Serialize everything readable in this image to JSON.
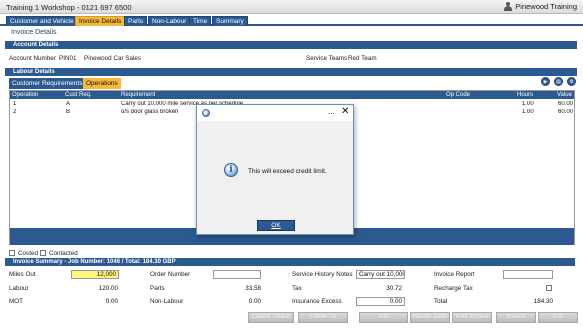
{
  "app": {
    "title": "Training 1 Workshop - 0121 697 6500",
    "user": "Pinewood Training"
  },
  "tabs": [
    {
      "label": "Customer and Vehicle"
    },
    {
      "label": "Invoice Details"
    },
    {
      "label": "Parts"
    },
    {
      "label": "Non-Labour"
    },
    {
      "label": "Time"
    },
    {
      "label": "Summary"
    }
  ],
  "breadcrumb": "Invoice Details",
  "account": {
    "header": "Account Details",
    "number_label": "Account Number",
    "number": "PIN01",
    "name": "Pinewood Car Sales",
    "service_teams_label": "Service Teams",
    "service_team": "Red Team"
  },
  "labour": {
    "header": "Labour Details",
    "inner_tabs": [
      "Customer Requirements",
      "Operations"
    ],
    "columns": [
      "Operation",
      "Cust Req.",
      "Requirement",
      "Op Code",
      "Hours",
      "Value"
    ],
    "rows": [
      {
        "operation": "1",
        "cust_req": "A",
        "requirement": "Carry out 10,000 mile service as per schedule",
        "op_code": "",
        "hours": "1.00",
        "value": "60.00"
      },
      {
        "operation": "2",
        "cust_req": "B",
        "requirement": "o/s door glass broken",
        "op_code": "",
        "hours": "1.00",
        "value": "60.00"
      }
    ]
  },
  "checks": {
    "costed": "Costed",
    "contacted": "Contacted"
  },
  "summary": {
    "header": "Invoice Summary - Job Number: 1046 / Total: 184.30 GBP",
    "miles_out_label": "Miles Out",
    "miles_out": "12,000",
    "labour_label": "Labour",
    "labour": "120.00",
    "mot_label": "MOT",
    "mot": "0.00",
    "order_number_label": "Order Number",
    "order_number": "",
    "parts_label": "Parts",
    "parts": "33.58",
    "non_labour_label": "Non-Labour",
    "non_labour": "0.00",
    "service_history_label": "Service History Notes",
    "service_history": "Carry out 10,000 mile",
    "tax_label": "Tax",
    "tax": "30.72",
    "insurance_excess_label": "Insurance Excess",
    "insurance_excess": "0.00",
    "invoice_report_label": "Invoice Report",
    "invoice_report": "",
    "recharge_tax_label": "Recharge Tax",
    "total_label": "Total",
    "total": "184.30"
  },
  "bottom_buttons": [
    "Labour Check",
    "Follow Up",
    "Add",
    "Handle Cash",
    "Print Invoice",
    "Invoice",
    "Exit"
  ],
  "dialog": {
    "dots": "...",
    "close": "✕",
    "info": "i",
    "message": "This will exceed credit limit.",
    "ok": "OK"
  }
}
